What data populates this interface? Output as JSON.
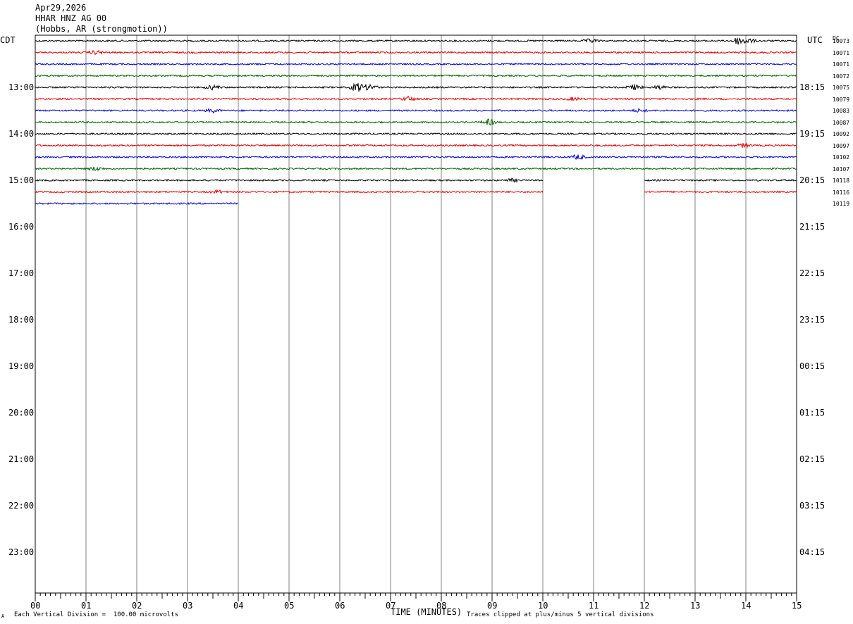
{
  "header": {
    "date": "Apr29,2026",
    "station": "HHAR HNZ AG 00",
    "location": "(Hobbs, AR (strongmotion))"
  },
  "left_timezone": "CDT",
  "right_timezone": "UTC",
  "dc_header": "DC",
  "footer": {
    "scale_note": "Each Vertical Division =  100.00 microvolts",
    "xlabel": "TIME (MINUTES)",
    "clip_note": "Traces clipped at plus/minus 5 vertical divisions",
    "corner_mark": "A"
  },
  "colors": {
    "trace_cycle": [
      "#000000",
      "#e00000",
      "#0000d0",
      "#006400"
    ],
    "grid": "#808080",
    "frame": "#000000"
  },
  "chart_data": {
    "type": "line",
    "title": "HHAR HNZ AG 00",
    "xlabel": "TIME (MINUTES)",
    "x_range": [
      0,
      15
    ],
    "x_ticks": [
      "00",
      "01",
      "02",
      "03",
      "04",
      "05",
      "06",
      "07",
      "08",
      "09",
      "10",
      "11",
      "12",
      "13",
      "14",
      "15"
    ],
    "left_hour_labels": [
      "13:00",
      "14:00",
      "15:00",
      "16:00",
      "17:00",
      "18:00",
      "19:00",
      "20:00",
      "21:00",
      "22:00",
      "23:00"
    ],
    "right_hour_labels": [
      "18:15",
      "19:15",
      "20:15",
      "21:15",
      "22:15",
      "23:15",
      "00:15",
      "01:15",
      "02:15",
      "03:15",
      "04:15"
    ],
    "rows_total": 48,
    "first_labeled_row": 4,
    "rows_per_hour": 4,
    "grid": true,
    "traces": [
      {
        "row": 0,
        "dc": "10073",
        "start_min": 0,
        "end_min": 15,
        "events": [
          {
            "min": 10.95,
            "amp": 2.5
          },
          {
            "min": 13.85,
            "amp": 5.0
          },
          {
            "min": 14.05,
            "amp": 3.0
          }
        ]
      },
      {
        "row": 1,
        "dc": "10071",
        "start_min": 0,
        "end_min": 15,
        "events": [
          {
            "min": 1.2,
            "amp": 2.5
          }
        ]
      },
      {
        "row": 2,
        "dc": "10071",
        "start_min": 0,
        "end_min": 15,
        "events": []
      },
      {
        "row": 3,
        "dc": "10072",
        "start_min": 0,
        "end_min": 15,
        "events": []
      },
      {
        "row": 4,
        "dc": "10075",
        "start_min": 0,
        "end_min": 15,
        "events": [
          {
            "min": 3.5,
            "amp": 3.0
          },
          {
            "min": 6.35,
            "amp": 6.0
          },
          {
            "min": 6.6,
            "amp": 4.0
          },
          {
            "min": 11.8,
            "amp": 3.5
          },
          {
            "min": 12.3,
            "amp": 2.5
          }
        ]
      },
      {
        "row": 5,
        "dc": "10079",
        "start_min": 0,
        "end_min": 15,
        "events": [
          {
            "min": 7.35,
            "amp": 3.0
          },
          {
            "min": 10.6,
            "amp": 2.0
          }
        ]
      },
      {
        "row": 6,
        "dc": "10083",
        "start_min": 0,
        "end_min": 15,
        "events": [
          {
            "min": 3.5,
            "amp": 2.5
          },
          {
            "min": 11.9,
            "amp": 2.0
          }
        ]
      },
      {
        "row": 7,
        "dc": "10087",
        "start_min": 0,
        "end_min": 15,
        "events": [
          {
            "min": 8.95,
            "amp": 4.0
          }
        ]
      },
      {
        "row": 8,
        "dc": "10092",
        "start_min": 0,
        "end_min": 15,
        "events": []
      },
      {
        "row": 9,
        "dc": "10097",
        "start_min": 0,
        "end_min": 15,
        "events": [
          {
            "min": 13.95,
            "amp": 2.5
          }
        ]
      },
      {
        "row": 10,
        "dc": "10102",
        "start_min": 0,
        "end_min": 15,
        "events": [
          {
            "min": 10.7,
            "amp": 3.5
          }
        ]
      },
      {
        "row": 11,
        "dc": "10107",
        "start_min": 0,
        "end_min": 15,
        "events": [
          {
            "min": 1.2,
            "amp": 2.5
          }
        ]
      },
      {
        "row": 12,
        "dc": "10118",
        "start_min": 0,
        "end_min": 10,
        "resume_min": 12,
        "events": [
          {
            "min": 9.4,
            "amp": 2.0
          }
        ]
      },
      {
        "row": 13,
        "dc": "10116",
        "start_min": 0,
        "end_min": 15,
        "gap": [
          10,
          12
        ],
        "events": [
          {
            "min": 3.6,
            "amp": 2.0
          }
        ]
      },
      {
        "row": 14,
        "dc": "10119",
        "start_min": 0,
        "end_min": 4,
        "events": []
      }
    ]
  }
}
